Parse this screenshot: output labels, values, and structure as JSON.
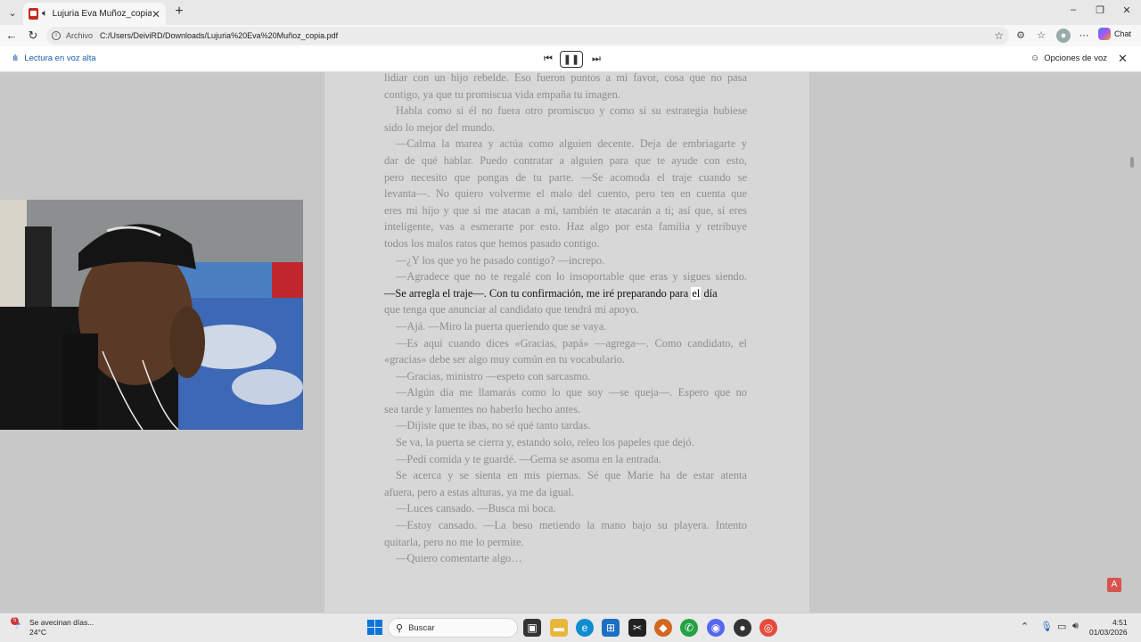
{
  "browser": {
    "tab_title": "Lujuria Eva Muñoz_copia.pdf",
    "new_tab": "+",
    "address_label": "Archivo",
    "url": "C:/Users/DeiviRD/Downloads/Lujuria%20Eva%20Muñoz_copia.pdf",
    "chat_label": "Chat",
    "window_controls": [
      "–",
      "❐",
      "✕"
    ]
  },
  "read_aloud": {
    "title": "Lectura en voz alta",
    "voice_options": "Opciones de voz"
  },
  "document": {
    "lines": [
      {
        "text": "lidiar con un hijo rebelde. Eso fueron puntos a mi favor, cosa que no pasa",
        "just": true,
        "indent": false
      },
      {
        "text": "contigo, ya que tu promiscua vida empaña tu imagen.",
        "just": false,
        "indent": false
      },
      {
        "text": "Habla como si él no fuera otro promiscuo y como si su estrategia hubiese",
        "just": true,
        "indent": true
      },
      {
        "text": "sido lo mejor del mundo.",
        "just": false,
        "indent": false
      },
      {
        "text": "—Calma la marea y actúa como alguien decente. Deja de embriagarte y",
        "just": true,
        "indent": true
      },
      {
        "text": "dar de qué hablar. Puedo contratar a alguien para que te ayude con esto,",
        "just": true,
        "indent": false
      },
      {
        "text": "pero necesito que pongas de tu parte. —Se acomoda el traje cuando se",
        "just": true,
        "indent": false
      },
      {
        "text": "levanta—. No quiero volverme el malo del cuento, pero ten en cuenta que",
        "just": true,
        "indent": false
      },
      {
        "text": "eres mi hijo y que si me atacan a mí, también te atacarán a ti; así que, si eres",
        "just": true,
        "indent": false
      },
      {
        "text": "inteligente, vas a esmerarte por esto. Haz algo por esta familia y retribuye",
        "just": true,
        "indent": false
      },
      {
        "text": "todos los malos ratos que hemos pasado contigo.",
        "just": false,
        "indent": false
      },
      {
        "text": "—¿Y los que yo he pasado contigo? —increpo.",
        "just": false,
        "indent": true
      },
      {
        "text": "—Agradece que no te regalé con lo insoportable que eras y sigues siendo.",
        "just": true,
        "indent": true
      },
      {
        "text": "",
        "just": false,
        "indent": false,
        "active": true
      },
      {
        "text": "que tenga que anunciar al candidato que tendrá mi apoyo.",
        "just": false,
        "indent": false
      },
      {
        "text": "—Ajá. —Miro la puerta queriendo que se vaya.",
        "just": false,
        "indent": true
      },
      {
        "text": "—Es aquí cuando dices «Gracias, papá» —agrega—. Como candidato, el",
        "just": true,
        "indent": true
      },
      {
        "text": "«gracias» debe ser algo muy común en tu vocabulario.",
        "just": false,
        "indent": false
      },
      {
        "text": "—Gracias, ministro —espeto con sarcasmo.",
        "just": false,
        "indent": true
      },
      {
        "text": "—Algún día me llamarás como lo que soy —se queja—. Espero que no",
        "just": true,
        "indent": true
      },
      {
        "text": "sea tarde y lamentes no haberlo hecho antes.",
        "just": false,
        "indent": false
      },
      {
        "text": "—Dijiste que te ibas, no sé qué tanto tardas.",
        "just": false,
        "indent": true
      },
      {
        "text": "Se va, la puerta se cierra y, estando solo, releo los papeles que dejó.",
        "just": false,
        "indent": true
      },
      {
        "text": "—Pedí comida y te guardé. —Gema se asoma en la entrada.",
        "just": false,
        "indent": true
      },
      {
        "text": "Se acerca y se sienta en mis piernas. Sé que Marie ha de estar atenta",
        "just": true,
        "indent": true
      },
      {
        "text": "afuera, pero a estas alturas, ya me da igual.",
        "just": false,
        "indent": false
      },
      {
        "text": "—Luces cansado. —Busca mi boca.",
        "just": false,
        "indent": true
      },
      {
        "text": "—Estoy cansado. —La beso metiendo la mano bajo su playera. Intento",
        "just": true,
        "indent": true
      },
      {
        "text": "quitarla, pero no me lo permite.",
        "just": false,
        "indent": false
      },
      {
        "text": "—Quiero comentarte algo…",
        "just": false,
        "indent": true
      }
    ],
    "active_line": {
      "before": "—Se arregla el traje—. Con tu confirmación, me iré preparando para ",
      "highlight": "el",
      "after": " día"
    }
  },
  "taskbar": {
    "weather_title": "Se avecinan días...",
    "weather_temp": "24°C",
    "weather_badge": "5",
    "search_placeholder": "Buscar",
    "time": "4:51",
    "date": "01/03/2026"
  }
}
